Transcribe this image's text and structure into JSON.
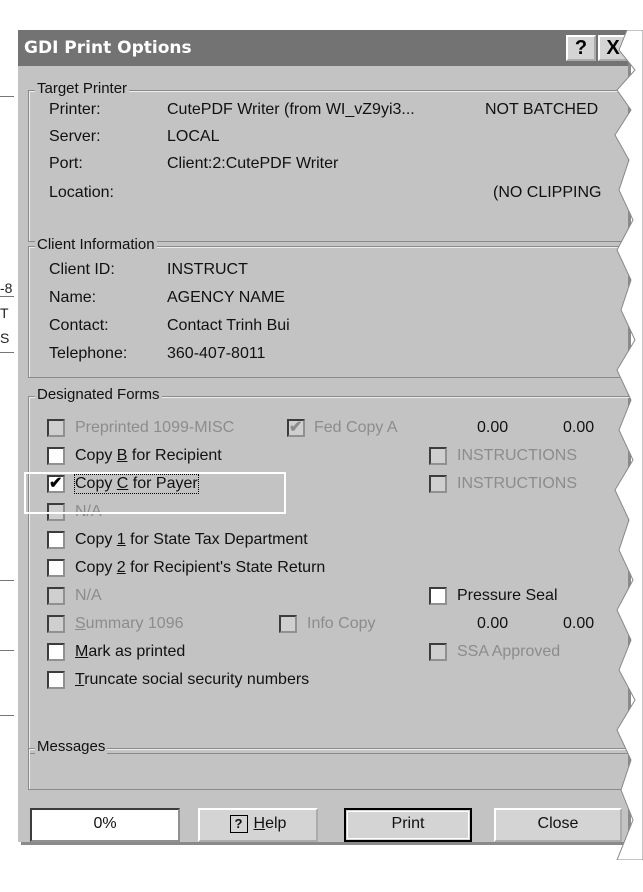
{
  "window": {
    "title": "GDI Print Options",
    "help_label": "?",
    "close_label": "X"
  },
  "target_printer": {
    "legend": "Target Printer",
    "printer_label": "Printer:",
    "printer_value": "CutePDF Writer (from WI_vZ9yi3...",
    "batch_status": "NOT BATCHED",
    "server_label": "Server:",
    "server_value": "LOCAL",
    "port_label": "Port:",
    "port_value": "Client:2:CutePDF Writer",
    "location_label": "Location:",
    "clipping_status": "(NO CLIPPING"
  },
  "client_info": {
    "legend": "Client Information",
    "client_id_label": "Client ID:",
    "client_id_value": "INSTRUCT",
    "name_label": "Name:",
    "name_value": "AGENCY NAME",
    "contact_label": "Contact:",
    "contact_value": "Contact Trinh Bui",
    "telephone_label": "Telephone:",
    "telephone_value": "360-407-8011"
  },
  "designated_forms": {
    "legend": "Designated Forms",
    "preprinted": {
      "label": "Preprinted 1099-MISC",
      "checked": false,
      "enabled": false
    },
    "fed_copy_a": {
      "label": "Fed Copy A",
      "checked": true,
      "enabled": false
    },
    "amount1": "0.00",
    "amount2": "0.00",
    "copy_b": {
      "label_pre": "Copy ",
      "label_u": "B",
      "label_post": " for Recipient",
      "checked": false
    },
    "instructions_b": {
      "label": "INSTRUCTIONS",
      "checked": false,
      "enabled": false
    },
    "copy_c": {
      "label_pre": "Copy ",
      "label_u": "C",
      "label_post": " for Payer",
      "checked": true
    },
    "instructions_c": {
      "label": "INSTRUCTIONS",
      "checked": false,
      "enabled": false
    },
    "na1": {
      "label": "N/A",
      "checked": false,
      "enabled": false
    },
    "copy_1": {
      "label_pre": "Copy ",
      "label_u": "1",
      "label_post": " for State Tax Department",
      "checked": false
    },
    "copy_2": {
      "label_pre": "Copy ",
      "label_u": "2",
      "label_post": " for Recipient's State Return",
      "checked": false
    },
    "na2": {
      "label": "N/A",
      "checked": false,
      "enabled": false
    },
    "pressure_seal": {
      "label": "Pressure Seal",
      "checked": false
    },
    "summary_1096": {
      "label_u": "S",
      "label_post": "ummary 1096",
      "checked": false,
      "enabled": false
    },
    "info_copy": {
      "label": "Info Copy",
      "checked": false,
      "enabled": false
    },
    "amount3": "0.00",
    "amount4": "0.00",
    "mark_printed": {
      "label_u": "M",
      "label_post": "ark as printed",
      "checked": false
    },
    "ssa_approved": {
      "label": "SSA Approved",
      "checked": false,
      "enabled": false
    },
    "truncate_ssn": {
      "label_u": "T",
      "label_post": "runcate social security numbers",
      "checked": false
    }
  },
  "messages": {
    "legend": "Messages"
  },
  "footer": {
    "progress": "0%",
    "help_icon": "?",
    "help_u": "H",
    "help_post": "elp",
    "print": "Print",
    "close": "Close"
  },
  "background": {
    "chars": [
      "-8",
      "T",
      "S"
    ]
  },
  "colors": {
    "titlebar": "#737373",
    "dialog_bg": "#c3c3c3",
    "disabled_text": "#8c8c8c"
  }
}
